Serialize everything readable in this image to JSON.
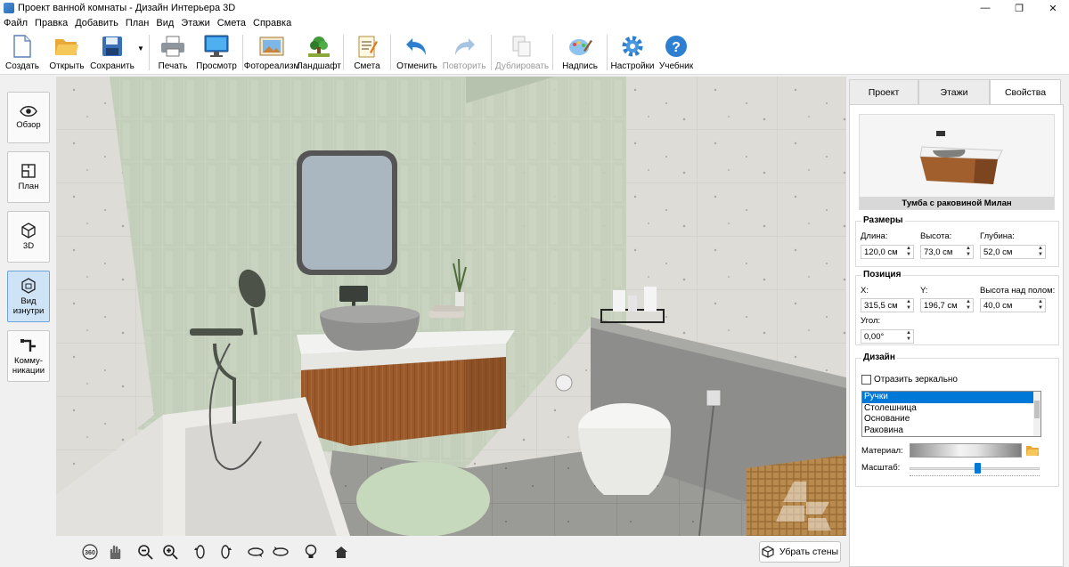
{
  "window": {
    "title": "Проект ванной комнаты - Дизайн Интерьера 3D",
    "minimize_glyph": "—",
    "restore_glyph": "❐",
    "close_glyph": "✕"
  },
  "menu": [
    "Файл",
    "Правка",
    "Добавить",
    "План",
    "Вид",
    "Этажи",
    "Смета",
    "Справка"
  ],
  "toolbar": {
    "create": "Создать",
    "open": "Открыть",
    "save": "Сохранить",
    "save_menu_glyph": "▼",
    "print": "Печать",
    "preview": "Просмотр",
    "photorealism": "Фотореализм",
    "landscape": "Ландшафт",
    "estimate": "Смета",
    "undo": "Отменить",
    "redo": "Повторить",
    "duplicate": "Дублировать",
    "label": "Надпись",
    "settings": "Настройки",
    "tutorial": "Учебник"
  },
  "sidebar": [
    {
      "label": "Обзор",
      "icon": "eye-icon"
    },
    {
      "label": "План",
      "icon": "floorplan-icon"
    },
    {
      "label": "3D",
      "icon": "cube-icon"
    },
    {
      "label": "Вид изнутри",
      "icon": "interior-view-icon",
      "active": true
    },
    {
      "label": "Комму-никации",
      "icon": "pipes-icon"
    }
  ],
  "bottom": {
    "rotate360": "360",
    "remove_walls": "Убрать стены"
  },
  "tabs": [
    "Проект",
    "Этажи",
    "Свойства"
  ],
  "active_tab": "Свойства",
  "object": {
    "name": "Тумба с раковиной Милан"
  },
  "sizes": {
    "title": "Размеры",
    "length_label": "Длина:",
    "length": "120,0 см",
    "height_label": "Высота:",
    "height": "73,0 см",
    "depth_label": "Глубина:",
    "depth": "52,0 см"
  },
  "position": {
    "title": "Позиция",
    "x_label": "X:",
    "x": "315,5 см",
    "y_label": "Y:",
    "y": "196,7 см",
    "elev_label": "Высота над полом:",
    "elev": "40,0 см",
    "angle_label": "Угол:",
    "angle": "0,00°"
  },
  "design": {
    "title": "Дизайн",
    "mirror_label": "Отразить зеркально",
    "mirror_checked": false,
    "parts": [
      "Ручки",
      "Столешница",
      "Основание",
      "Раковина"
    ],
    "selected_part": "Ручки",
    "material_label": "Материал:",
    "scale_label": "Масштаб:",
    "scale_value": 0.55
  }
}
